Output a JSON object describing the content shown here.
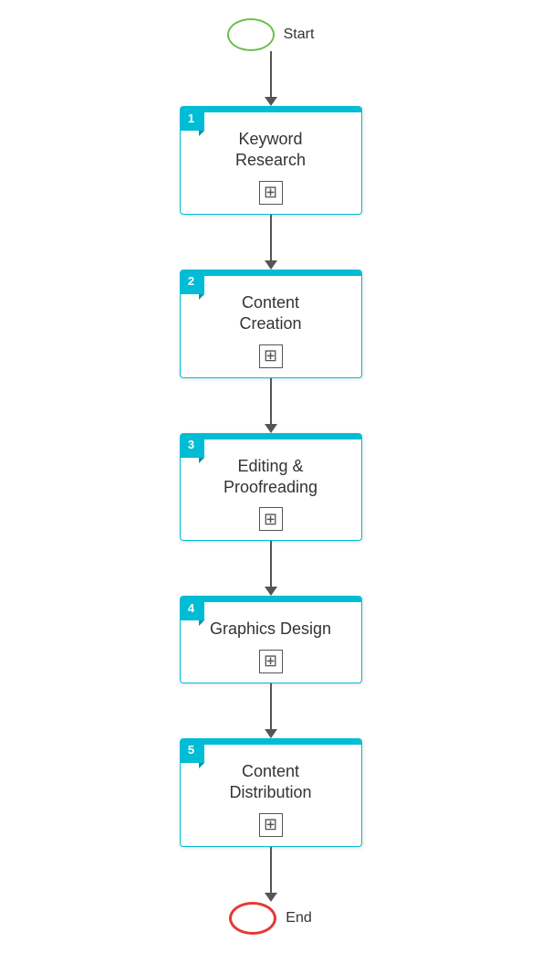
{
  "start_label": "Start",
  "end_label": "End",
  "steps": [
    {
      "number": "1",
      "title": "Keyword\nResearch"
    },
    {
      "number": "2",
      "title": "Content\nCreation"
    },
    {
      "number": "3",
      "title": "Editing &\nProofreading"
    },
    {
      "number": "4",
      "title": "Graphics Design"
    },
    {
      "number": "5",
      "title": "Content\nDistribution"
    }
  ],
  "plus_icon": "⊞",
  "colors": {
    "accent": "#00bcd4",
    "start_border": "#6abf4b",
    "end_border": "#e53935",
    "arrow": "#555555",
    "text": "#333333"
  }
}
